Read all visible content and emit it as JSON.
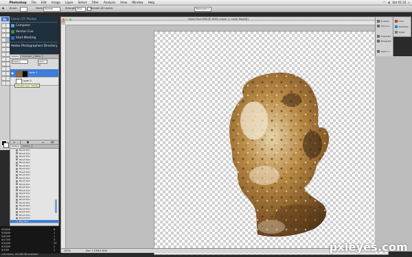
{
  "menubar": {
    "apple_icon": "apple-icon",
    "items": [
      "Photoshop",
      "File",
      "Edit",
      "Image",
      "Layer",
      "Select",
      "Filter",
      "Analysis",
      "View",
      "Window",
      "Help"
    ],
    "clock": "Sat 01:32",
    "extras_label": "Workspace ▾"
  },
  "options": {
    "mode_label": "Mode:",
    "mode_value": "Normal",
    "opacity_label": "Opacity:",
    "opacity_value": "100%",
    "flow_label": "Flow:",
    "flow_value": "100%",
    "brush_label": "Brush:",
    "sample_label": "Sample All Layers",
    "strength_label": "Strength:",
    "strength_value": "50%"
  },
  "dock": {
    "header": "Canon ST: Photos",
    "items": [
      "Computer",
      "Version Cue",
      "Start Meeting",
      "Adobe Photographers Directory"
    ]
  },
  "layers": {
    "tabs": [
      "Layers",
      "Channels",
      "Paths"
    ],
    "blend_mode": "Multiply",
    "opacity": "100%",
    "fill_label": "Fill:",
    "rows": [
      {
        "name": "Layer 1",
        "selected": true
      },
      {
        "name": "Layer 0",
        "selected": false
      }
    ],
    "tooltip": "Indicates layer visibility"
  },
  "history": {
    "tabs": [
      "History",
      "Actions"
    ],
    "rows": [
      "Brush Tool",
      "Brush Tool",
      "Brush Tool",
      "Brush Tool",
      "Brush Tool",
      "Brush Tool",
      "Brush Tool",
      "Brush Tool",
      "Brush Tool",
      "Brush Tool",
      "Brush Tool",
      "Brush Tool",
      "Brush Tool",
      "Brush Tool",
      "Brush Tool",
      "Brush Tool",
      "Brush Tool",
      "Brush Tool",
      "Brush Tool",
      "Brush Tool",
      "Brush Tool",
      "Brush Tool",
      "Brush Tool",
      "Blur Tool"
    ]
  },
  "taskbar": {
    "rows": [
      {
        "date": "5/26/09",
        "n": "6"
      },
      {
        "date": "5/28/09",
        "n": "1"
      },
      {
        "date": "5/31/09",
        "n": "1"
      },
      {
        "date": "5/17/09",
        "n": "3"
      },
      {
        "date": "5/14/09",
        "n": "23"
      },
      {
        "date": "5/15/09",
        "n": "1"
      },
      {
        "date": "5/7/09",
        "n": "1"
      }
    ]
  },
  "document": {
    "title": "David Face.PSD @ 100% (Layer 1, Layer Mask/8)",
    "zoom": "100%",
    "doc_info": "Doc: 1.03M/1.61M",
    "bottom_info": "116 items, 155.68 GB available"
  },
  "mini_panel": {
    "left_items": [
      "Brushes",
      "Clone S..."
    ],
    "left_items2": [
      "Character",
      "Paragraph"
    ],
    "left_items3": [
      "Layer C..."
    ],
    "right_items": [
      "Color",
      "Swatches",
      "Styles"
    ]
  },
  "watermark": "pxleyes.com",
  "colors": {
    "accent": "#3d7ddb",
    "dock_bg": "#1f2f3c",
    "stone_dark": "#3a2614",
    "stone_light": "#e9dcc0",
    "stone_mid": "#9a6a32"
  }
}
